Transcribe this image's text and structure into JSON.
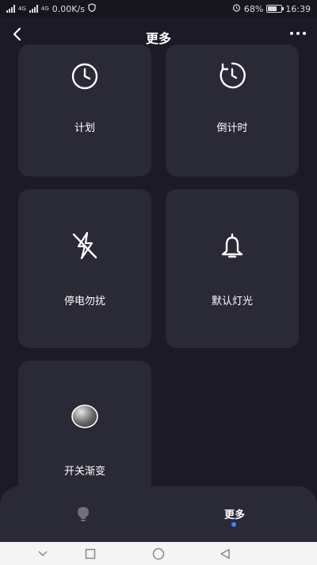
{
  "status_bar": {
    "signal1": "4G",
    "signal2": "4G",
    "speed": "0.00K/s",
    "battery_percent": "68%",
    "battery_level": 0.68,
    "time": "16:39"
  },
  "header": {
    "title": "更多"
  },
  "cards": [
    {
      "label": "计划",
      "icon": "clock-icon"
    },
    {
      "label": "倒计时",
      "icon": "countdown-icon"
    },
    {
      "label": "停电勿扰",
      "icon": "power-off-icon"
    },
    {
      "label": "默认灯光",
      "icon": "bell-icon"
    },
    {
      "label": "开关渐变",
      "icon": "gradient-ball-icon"
    }
  ],
  "bottom_bar": {
    "more_label": "更多",
    "active_color": "#2f8cff"
  }
}
